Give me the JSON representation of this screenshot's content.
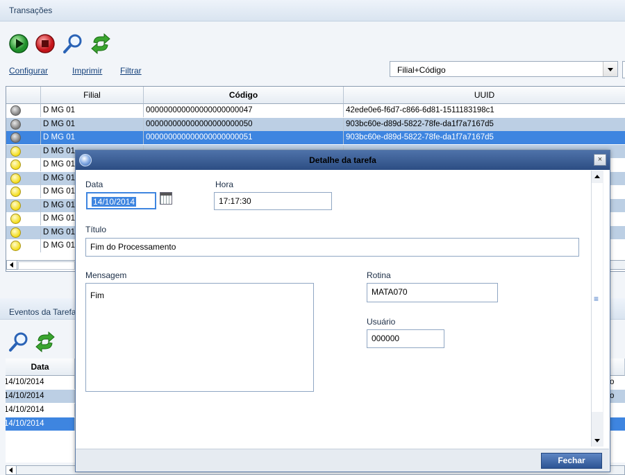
{
  "top_panel": {
    "title": "Transações",
    "toolbar_icons": [
      "play-icon",
      "stop-icon",
      "search-icon",
      "refresh-icon"
    ],
    "links": {
      "configure": "Configurar",
      "print": "Imprimir",
      "filter": "Filtrar"
    },
    "order_select": "Filial+Código"
  },
  "grid": {
    "headers": {
      "branch": "Filial",
      "code": "Código",
      "uuid": "UUID"
    },
    "rows": [
      {
        "status": "gray",
        "branch": "D MG 01",
        "code": "000000000000000000000047",
        "uuid": "42ede0e6-f6d7-c866-6d81-1511183198c1"
      },
      {
        "status": "gray",
        "branch": "D MG 01",
        "code": "000000000000000000000050",
        "uuid": "903bc60e-d89d-5822-78fe-da1f7a7167d5"
      },
      {
        "status": "gray",
        "branch": "D MG 01",
        "code": "000000000000000000000051",
        "uuid": "903bc60e-d89d-5822-78fe-da1f7a7167d5"
      },
      {
        "status": "yellow",
        "branch": "D MG 01",
        "code": "",
        "uuid": ""
      },
      {
        "status": "yellow",
        "branch": "D MG 01",
        "code": "",
        "uuid": ""
      },
      {
        "status": "yellow",
        "branch": "D MG 01",
        "code": "",
        "uuid": ""
      },
      {
        "status": "yellow",
        "branch": "D MG 01",
        "code": "",
        "uuid": ""
      },
      {
        "status": "yellow",
        "branch": "D MG 01",
        "code": "",
        "uuid": ""
      },
      {
        "status": "yellow",
        "branch": "D MG 01",
        "code": "",
        "uuid": ""
      },
      {
        "status": "yellow",
        "branch": "D MG 01",
        "code": "",
        "uuid": ""
      },
      {
        "status": "yellow",
        "branch": "D MG 01",
        "code": "",
        "uuid": ""
      }
    ]
  },
  "bottom_panel": {
    "title": "Eventos da Tarefa",
    "toolbar_icons": [
      "search-icon",
      "refresh-icon"
    ],
    "header_date": "Data",
    "rows": [
      {
        "date": "14/10/2014",
        "tail": "o"
      },
      {
        "date": "14/10/2014",
        "tail": "o"
      },
      {
        "date": "14/10/2014",
        "tail": ""
      },
      {
        "date": "14/10/2014",
        "tail": ""
      }
    ]
  },
  "modal": {
    "title": "Detalhe da tarefa",
    "labels": {
      "date": "Data",
      "time": "Hora",
      "title": "Título",
      "message": "Mensagem",
      "routine": "Rotina",
      "user": "Usuário"
    },
    "values": {
      "date": "14/10/2014",
      "time": "17:17:30",
      "title": "Fim do Processamento",
      "message": "Fim",
      "routine": "MATA070",
      "user": "000000"
    },
    "close_button": "Fechar",
    "close_icon": "×"
  },
  "colors": {
    "selected_row": "#3e85e0",
    "alt_row": "#bccfe4",
    "title_bar": "#2c4d83"
  }
}
